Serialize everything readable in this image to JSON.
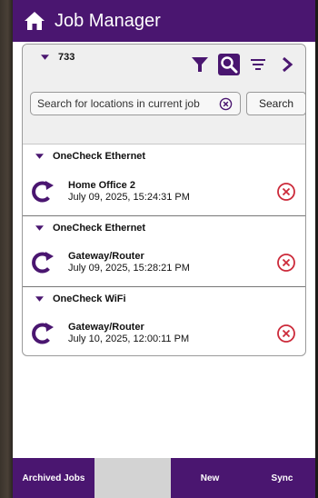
{
  "app": {
    "title": "Job Manager",
    "accent": "#4a1670",
    "danger": "#cc2a3a"
  },
  "job": {
    "id": "733"
  },
  "toolbar": {
    "icons": [
      "filter-icon",
      "search-icon",
      "sort-icon",
      "chevron-right-icon"
    ],
    "active": "search-icon"
  },
  "search": {
    "placeholder": "Search for locations in current job",
    "button_label": "Search"
  },
  "groups": [
    {
      "label": "OneCheck Ethernet",
      "entry": {
        "name": "Home Office 2",
        "time": "July 09, 2025, 15:24:31 PM"
      }
    },
    {
      "label": "OneCheck Ethernet",
      "entry": {
        "name": "Gateway/Router",
        "time": "July 09, 2025, 15:28:21 PM"
      }
    },
    {
      "label": "OneCheck WiFi",
      "entry": {
        "name": "Gateway/Router",
        "time": "July 10, 2025, 12:00:11 PM"
      }
    }
  ],
  "bottom_bar": {
    "archived_label": "Archived Jobs",
    "new_label": "New",
    "sync_label": "Sync"
  }
}
